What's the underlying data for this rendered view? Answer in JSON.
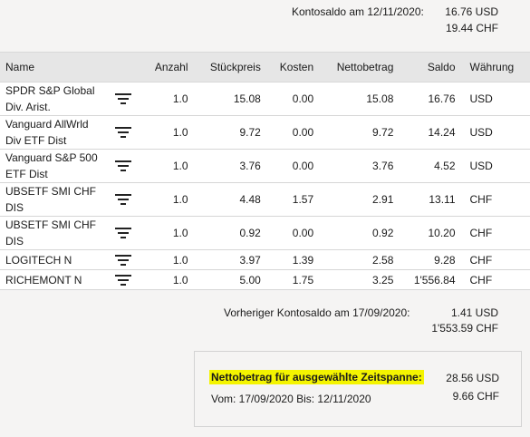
{
  "header": {
    "balance_label": "Kontosaldo am 12/11/2020:",
    "balance_usd": "16.76 USD",
    "balance_chf": "19.44 CHF"
  },
  "table": {
    "columns": [
      "Name",
      "Anzahl",
      "Stückpreis",
      "Kosten",
      "Nettobetrag",
      "Saldo",
      "Währung"
    ],
    "rows": [
      {
        "name": "SPDR S&P Global Div. Arist.",
        "anzahl": "1.0",
        "stueckpreis": "15.08",
        "kosten": "0.00",
        "netto": "15.08",
        "saldo": "16.76",
        "waehrung": "USD"
      },
      {
        "name": "Vanguard AllWrld Div ETF Dist",
        "anzahl": "1.0",
        "stueckpreis": "9.72",
        "kosten": "0.00",
        "netto": "9.72",
        "saldo": "14.24",
        "waehrung": "USD"
      },
      {
        "name": "Vanguard S&P 500 ETF Dist",
        "anzahl": "1.0",
        "stueckpreis": "3.76",
        "kosten": "0.00",
        "netto": "3.76",
        "saldo": "4.52",
        "waehrung": "USD"
      },
      {
        "name": "UBSETF SMI CHF DIS",
        "anzahl": "1.0",
        "stueckpreis": "4.48",
        "kosten": "1.57",
        "netto": "2.91",
        "saldo": "13.11",
        "waehrung": "CHF"
      },
      {
        "name": "UBSETF SMI CHF DIS",
        "anzahl": "1.0",
        "stueckpreis": "0.92",
        "kosten": "0.00",
        "netto": "0.92",
        "saldo": "10.20",
        "waehrung": "CHF"
      },
      {
        "name": "LOGITECH N",
        "anzahl": "1.0",
        "stueckpreis": "3.97",
        "kosten": "1.39",
        "netto": "2.58",
        "saldo": "9.28",
        "waehrung": "CHF"
      },
      {
        "name": "RICHEMONT N",
        "anzahl": "1.0",
        "stueckpreis": "5.00",
        "kosten": "1.75",
        "netto": "3.25",
        "saldo": "1'556.84",
        "waehrung": "CHF"
      }
    ]
  },
  "previous": {
    "label": "Vorheriger Kontosaldo am 17/09/2020:",
    "usd": "1.41 USD",
    "chf": "1'553.59 CHF"
  },
  "summary": {
    "label": "Nettobetrag für ausgewählte Zeitspanne:",
    "range": "Vom: 17/09/2020 Bis: 12/11/2020",
    "usd": "28.56 USD",
    "chf": "9.66 CHF"
  },
  "colors": {
    "highlight": "#f4f400",
    "header_bg": "#e6e6e6"
  }
}
